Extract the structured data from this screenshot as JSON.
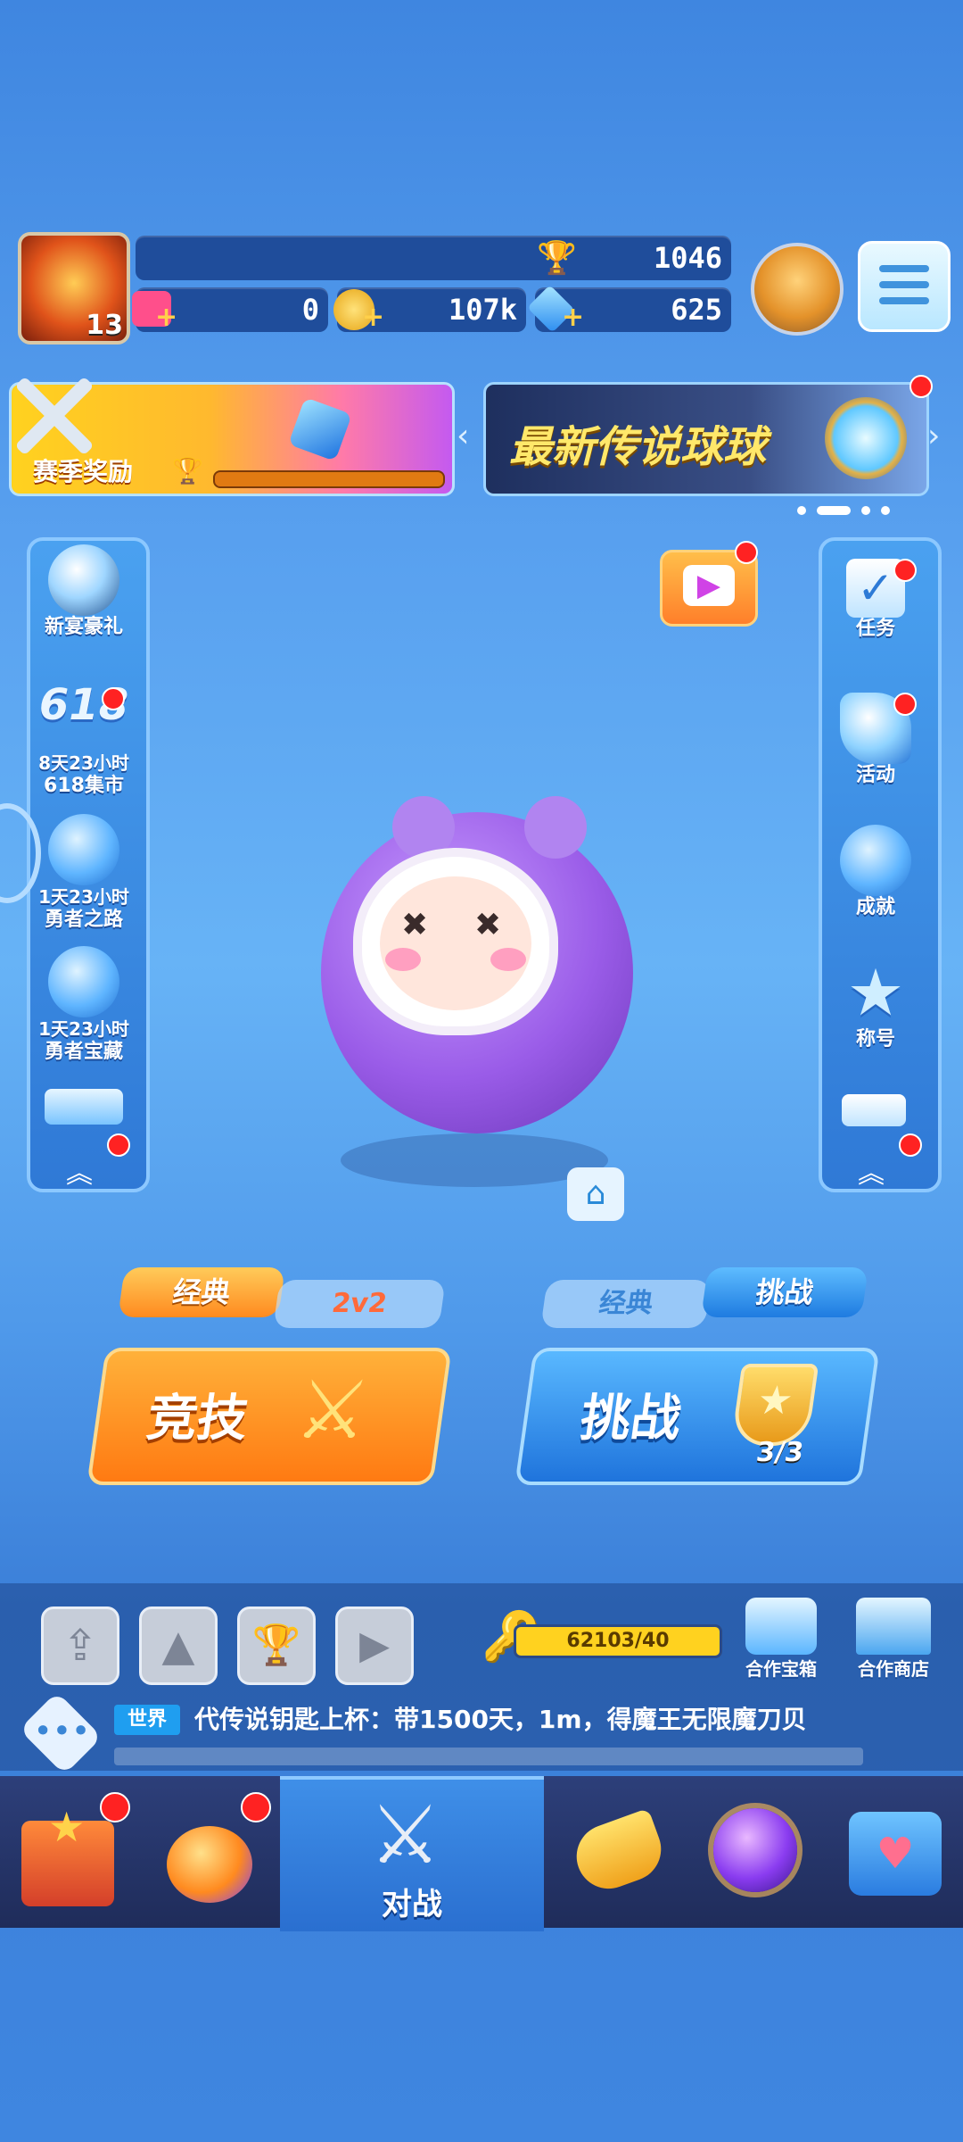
{
  "player": {
    "level": "13"
  },
  "resources": {
    "trophies": "1046",
    "tickets": "0",
    "coins": "107k",
    "diamonds": "625"
  },
  "banners": {
    "season_reward": "赛季奖励",
    "legend_ball": "最新传说球球"
  },
  "left_sidebar": [
    {
      "label": "新宴豪礼",
      "sub": ""
    },
    {
      "label": "618集市",
      "sub": "8天23小时",
      "badge": "618"
    },
    {
      "label": "勇者之路",
      "sub": "1天23小时"
    },
    {
      "label": "勇者宝藏",
      "sub": "1天23小时"
    }
  ],
  "right_sidebar": [
    {
      "label": "任务"
    },
    {
      "label": "活动"
    },
    {
      "label": "成就"
    },
    {
      "label": "称号"
    }
  ],
  "modes": {
    "left_tab_active": "经典",
    "left_tab_inactive": "2v2",
    "left_main": "竞技",
    "right_tab_inactive": "经典",
    "right_tab_active": "挑战",
    "right_main": "挑战",
    "challenge_count": "3/3"
  },
  "key_progress": "62103/40",
  "shop_labels": {
    "coop_chest": "合作宝箱",
    "coop_shop": "合作商店"
  },
  "chat": {
    "channel": "世界",
    "message": "代传说钥匙上杯：带1500天，1m，得魔王无限魔刀贝"
  },
  "bottom_nav": {
    "battle": "对战"
  },
  "colors": {
    "accent_orange": "#ff8a1f",
    "accent_blue": "#2d8cf0",
    "badge_red": "#f22222"
  }
}
